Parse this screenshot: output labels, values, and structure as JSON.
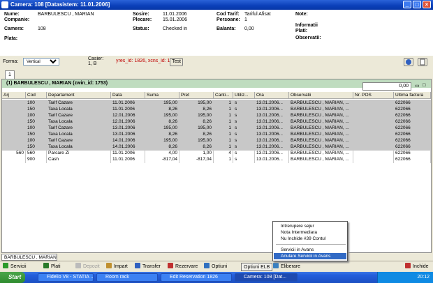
{
  "window": {
    "title": "Camera: 108  [Datasistem: 11.01.2006]",
    "min": "_",
    "max": "□",
    "close": "×"
  },
  "info": {
    "nume_label": "Nume:",
    "nume": "BARBULESCU , MARIAN",
    "companie_label": "Companie:",
    "camera_label": "Camera:",
    "camera": "108",
    "plata_label": "Plata:",
    "sosire_label": "Sosire:",
    "sosire": "11.01.2006",
    "plecare_label": "Plecare:",
    "plecare": "15.01.2006",
    "status_label": "Status:",
    "status": "Checked in",
    "codtarif_label": "Cod Tarif:",
    "codtarif": "Tariful Afisat",
    "persoane_label": "Persoane:",
    "persoane": "1",
    "balanta_label": "Balanta:",
    "balanta": "0,00",
    "note_label": "Note:",
    "informatii_label": "Informatii",
    "plati_label": "Plati:",
    "observatii_label": "Observatii:"
  },
  "toolbar": {
    "forma_label": "Forma:",
    "forma_value": "Vertical",
    "casier_label": "Casier:",
    "casier_value": "1, B",
    "ids_text": "yres_id: 1826, xcns_id: 1",
    "test_label": "Test"
  },
  "tab1": "1",
  "group": {
    "header": "(1)  BARBULESCU , MARIAN (zwin_id: 1753)",
    "total": "0,00"
  },
  "columns": [
    "Arj",
    "Cod",
    "Departament",
    "Data",
    "Suma",
    "Pret",
    "Canti...",
    "Utiliz...",
    "Ora",
    "Observatii",
    "Nr. POS",
    "Ultima factura"
  ],
  "rows": [
    {
      "arj": "",
      "cod": "100",
      "dep": "Tarif Cazare",
      "data": "11.01.2006",
      "suma": "195,00",
      "pret": "195,00",
      "cant": "1",
      "util": "s",
      "ora": "13.01.2006...",
      "obs": "BARBULESCU , MARIAN, ...",
      "pos": "",
      "fact": "622066"
    },
    {
      "arj": "",
      "cod": "150",
      "dep": "Taxa Locala",
      "data": "11.01.2006",
      "suma": "8,26",
      "pret": "8,26",
      "cant": "1",
      "util": "s",
      "ora": "13.01.2006...",
      "obs": "BARBULESCU , MARIAN, ...",
      "pos": "",
      "fact": "622066"
    },
    {
      "arj": "",
      "cod": "100",
      "dep": "Tarif Cazare",
      "data": "12.01.2006",
      "suma": "195,00",
      "pret": "195,00",
      "cant": "1",
      "util": "s",
      "ora": "13.01.2006...",
      "obs": "BARBULESCU , MARIAN, ...",
      "pos": "",
      "fact": "622066"
    },
    {
      "arj": "",
      "cod": "150",
      "dep": "Taxa Locala",
      "data": "12.01.2006",
      "suma": "8,26",
      "pret": "8,26",
      "cant": "1",
      "util": "s",
      "ora": "13.01.2006...",
      "obs": "BARBULESCU , MARIAN, ...",
      "pos": "",
      "fact": "622066"
    },
    {
      "arj": "",
      "cod": "100",
      "dep": "Tarif Cazare",
      "data": "13.01.2006",
      "suma": "195,00",
      "pret": "195,00",
      "cant": "1",
      "util": "s",
      "ora": "13.01.2006...",
      "obs": "BARBULESCU , MARIAN, ...",
      "pos": "",
      "fact": "622066"
    },
    {
      "arj": "",
      "cod": "150",
      "dep": "Taxa Locala",
      "data": "13.01.2006",
      "suma": "8,26",
      "pret": "8,26",
      "cant": "1",
      "util": "s",
      "ora": "13.01.2006...",
      "obs": "BARBULESCU , MARIAN, ...",
      "pos": "",
      "fact": "622066"
    },
    {
      "arj": "",
      "cod": "100",
      "dep": "Tarif Cazare",
      "data": "14.01.2006",
      "suma": "195,00",
      "pret": "195,00",
      "cant": "1",
      "util": "s",
      "ora": "13.01.2006...",
      "obs": "BARBULESCU , MARIAN, ...",
      "pos": "",
      "fact": "622066"
    },
    {
      "arj": "",
      "cod": "150",
      "dep": "Taxa Locala",
      "data": "14.01.2006",
      "suma": "8,26",
      "pret": "8,26",
      "cant": "1",
      "util": "s",
      "ora": "13.01.2006...",
      "obs": "BARBULESCU , MARIAN, ...",
      "pos": "",
      "fact": "622066"
    },
    {
      "arj": "560",
      "cod": "560",
      "dep": "Parcare Zi",
      "data": "11.01.2006",
      "suma": "4,00",
      "pret": "1,00",
      "cant": "4",
      "util": "s",
      "ora": "13.01.2006...",
      "obs": "BARBULESCU , MARIAN, ...",
      "pos": "",
      "fact": "622066"
    },
    {
      "arj": "",
      "cod": "900",
      "dep": "Cash",
      "data": "11.01.2006",
      "suma": "-817,04",
      "pret": "-817,04",
      "cant": "1",
      "util": "s",
      "ora": "13.01.2006...",
      "obs": "BARBULESCU , MARIAN, ...",
      "pos": "",
      "fact": "622066"
    }
  ],
  "bottom_tab": "BARBULESCU , MARIAN",
  "buttons": [
    "Servicii",
    "Plati",
    "Depozit",
    "Impart",
    "Transfer",
    "Rezervare",
    "Optiuni",
    "Optiuni ELB",
    "Eliberare",
    "Inchide"
  ],
  "menu": [
    "Intrerupere sejur",
    "Nota Intermediara",
    "Nu Inchide #39 Contul",
    "Servicii in Avans",
    "Anulare Servicii in Avans"
  ],
  "taskbar": {
    "start": "Start",
    "items": [
      "Fidelio V8 - STATIA ...",
      "Room rack",
      "Edit Reservation 1826",
      "Camera: 108  [Dat..."
    ],
    "clock": "20:12"
  },
  "colors": {
    "title": "#0a3fb8",
    "group": "#bfdcbf",
    "selected_row": "#c8c8c8",
    "menu_highlight": "#316ac5",
    "id_text": "#c00000"
  }
}
